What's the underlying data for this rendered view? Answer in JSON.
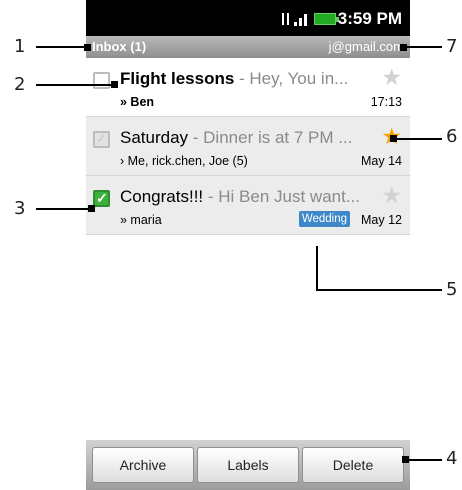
{
  "status_bar": {
    "time": "3:59 PM"
  },
  "header": {
    "title": "Inbox (1)",
    "account": "j@gmail.com"
  },
  "messages": [
    {
      "subject": "Flight lessons",
      "snippet": " - Hey, You in...",
      "participants": "» Ben",
      "time": "17:13",
      "starred": false,
      "unread": true,
      "checked": false
    },
    {
      "subject": "Saturday",
      "snippet": " - Dinner is at 7 PM ...",
      "participants": "› Me, rick.chen, Joe (5)",
      "time": "May 14",
      "starred": true,
      "unread": false,
      "checked": false
    },
    {
      "subject": "Congrats!!!",
      "snippet": " - Hi Ben Just want...",
      "participants": "» maria",
      "time": "May 12",
      "label": "Wedding",
      "starred": false,
      "unread": false,
      "checked": true
    }
  ],
  "buttons": {
    "archive": "Archive",
    "labels": "Labels",
    "delete": "Delete"
  },
  "callouts": {
    "c1": "1",
    "c2": "2",
    "c3": "3",
    "c4": "4",
    "c5": "5",
    "c6": "6",
    "c7": "7"
  },
  "colors": {
    "label_badge": "#3e87c9",
    "star_on": "#f5a200",
    "checkbox_checked": "#3cb23c"
  }
}
